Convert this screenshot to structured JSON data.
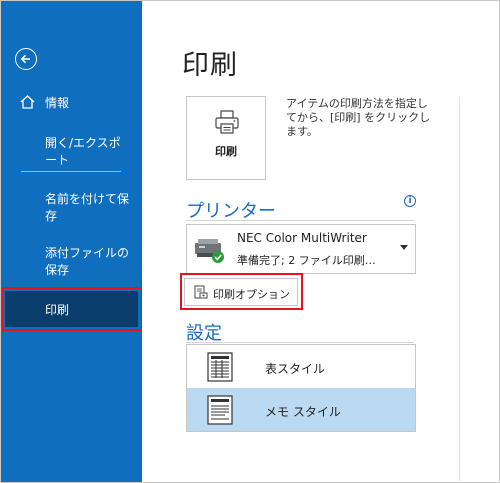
{
  "sidebar": {
    "back_icon": "back-arrow-icon",
    "items": [
      {
        "label": "情報",
        "icon": "home-icon"
      },
      {
        "label": "開く/エクスポート"
      },
      {
        "label": "名前を付けて保存"
      },
      {
        "label": "添付ファイルの保存"
      },
      {
        "label": "印刷",
        "active": true
      }
    ],
    "background_color": "#106ebe",
    "active_color": "#0a3d6b"
  },
  "main": {
    "title": "印刷",
    "print_button": {
      "label": "印刷",
      "icon": "printer-icon"
    },
    "description": "アイテムの印刷方法を指定してから、[印刷] をクリックします。",
    "printer_section": {
      "title": "プリンター",
      "info_icon": "info-icon",
      "selected_printer": {
        "name": "NEC Color MultiWriter",
        "status": "準備完了; 2 ファイル印刷…",
        "status_icon": "checkmark-icon"
      },
      "options_button": {
        "label": "印刷オプション",
        "icon": "print-options-icon"
      }
    },
    "settings_section": {
      "title": "設定",
      "styles": [
        {
          "label": "表スタイル",
          "icon": "table-style-icon",
          "selected": false
        },
        {
          "label": "メモ スタイル",
          "icon": "memo-style-icon",
          "selected": true
        }
      ]
    }
  },
  "colors": {
    "accent": "#1a6bc0",
    "highlight_border": "#e8121e",
    "selected_style": "#bcd9f2"
  }
}
